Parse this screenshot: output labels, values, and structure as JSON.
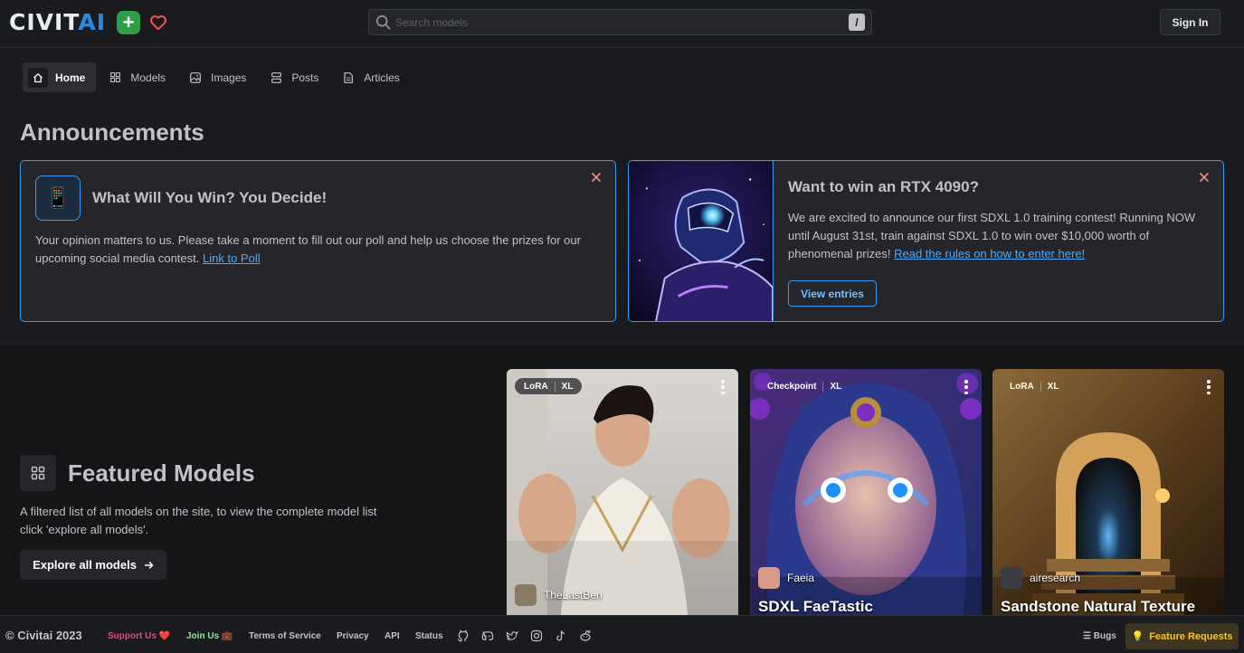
{
  "header": {
    "logo": {
      "part1": "CIVIT",
      "part2": "AI"
    },
    "search": {
      "placeholder": "Search models",
      "shortcut": "/"
    },
    "sign_in_label": "Sign In"
  },
  "nav": {
    "items": [
      {
        "label": "Home",
        "icon": "home-icon",
        "active": true
      },
      {
        "label": "Models",
        "icon": "category-icon"
      },
      {
        "label": "Images",
        "icon": "photo-icon"
      },
      {
        "label": "Posts",
        "icon": "layout-list-icon"
      },
      {
        "label": "Articles",
        "icon": "file-text-icon"
      }
    ]
  },
  "announcements": {
    "title": "Announcements",
    "cards": [
      {
        "icon": "📱",
        "title": "What Will You Win? You Decide!",
        "body": "Your opinion matters to us. Please take a moment to fill out our poll and help us choose the prizes for our upcoming social media contest.",
        "link": "Link to Poll"
      },
      {
        "title": "Want to win an RTX 4090?",
        "body": "We are excited to announce our first SDXL 1.0 training contest! Running NOW until August 31st, train against SDXL 1.0 to win over $10,000 worth of phenomenal prizes!",
        "link": "Read the rules on how to enter here!",
        "button": "View entries"
      }
    ]
  },
  "featured": {
    "title": "Featured Models",
    "description": "A filtered list of all models on the site, to view the complete model list click 'explore all models'.",
    "button": "Explore all models",
    "models": [
      {
        "badges": [
          "LoRA",
          "XL"
        ],
        "creator": "TheLastBen",
        "name": ""
      },
      {
        "badges": [
          "Checkpoint",
          "XL"
        ],
        "creator": "Faeia",
        "name": "SDXL FaeTastic"
      },
      {
        "badges": [
          "LoRA",
          "XL"
        ],
        "creator": "airesearch",
        "name": "Sandstone Natural Texture"
      }
    ]
  },
  "footer": {
    "copyright": "© Civitai 2023",
    "support": "Support Us ❤️",
    "join": "Join Us 💼",
    "terms": "Terms of Service",
    "privacy": "Privacy",
    "api": "API",
    "status": "Status",
    "bugs": "Bugs",
    "feature_requests": "Feature Requests"
  },
  "colors": {
    "accent": "#339af0",
    "background": "#1a1b1e",
    "card": "#25262b",
    "success": "#2f9e44"
  }
}
